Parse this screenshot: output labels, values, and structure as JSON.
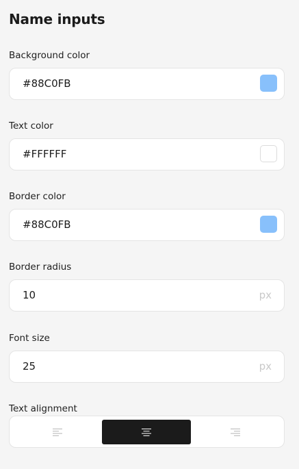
{
  "section": {
    "title": "Name inputs"
  },
  "fields": {
    "background_color": {
      "label": "Background color",
      "value": "#88C0FB",
      "swatch": "#88C0FB"
    },
    "text_color": {
      "label": "Text color",
      "value": "#FFFFFF",
      "swatch": "#FFFFFF"
    },
    "border_color": {
      "label": "Border color",
      "value": "#88C0FB",
      "swatch": "#88C0FB"
    },
    "border_radius": {
      "label": "Border radius",
      "value": "10",
      "unit": "px"
    },
    "font_size": {
      "label": "Font size",
      "value": "25",
      "unit": "px"
    }
  },
  "text_alignment": {
    "label": "Text alignment",
    "options": [
      {
        "id": "left",
        "icon": "align-left-icon"
      },
      {
        "id": "center",
        "icon": "align-center-icon"
      },
      {
        "id": "right",
        "icon": "align-right-icon"
      }
    ],
    "selected": "center"
  },
  "colors": {
    "active_button": "#1B1B1B",
    "inactive_icon": "#B5B5B5",
    "active_icon": "#FFFFFF"
  }
}
